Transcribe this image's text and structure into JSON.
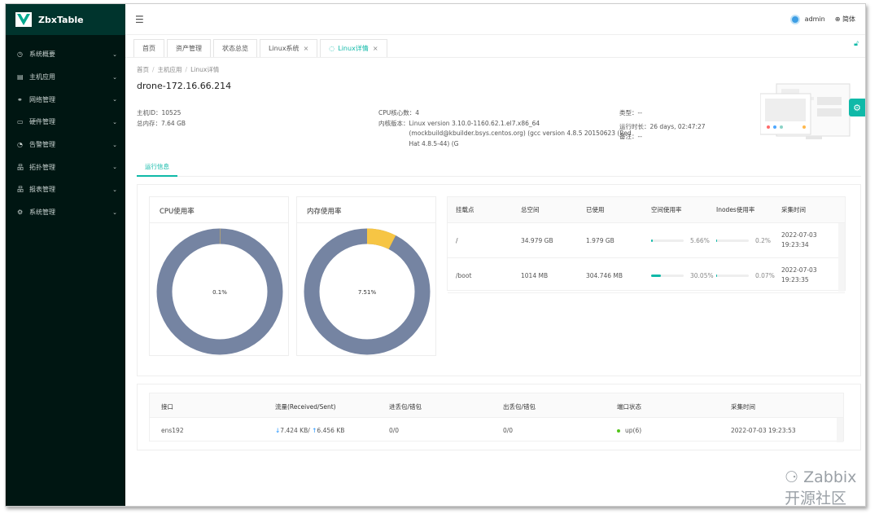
{
  "app": {
    "title": "ZbxTable"
  },
  "sidebar": {
    "items": [
      {
        "label": "系统概要",
        "icon": "dashboard-icon",
        "glyph": "◷"
      },
      {
        "label": "主机应用",
        "icon": "server-icon",
        "glyph": "▤"
      },
      {
        "label": "网络管理",
        "icon": "network-icon",
        "glyph": "⚭"
      },
      {
        "label": "硬件管理",
        "icon": "folder-icon",
        "glyph": "▭"
      },
      {
        "label": "告警管理",
        "icon": "alarm-icon",
        "glyph": "◔"
      },
      {
        "label": "拓扑管理",
        "icon": "topology-icon",
        "glyph": "品"
      },
      {
        "label": "报表管理",
        "icon": "report-icon",
        "glyph": "品"
      },
      {
        "label": "系统管理",
        "icon": "gear-icon",
        "glyph": "⚙"
      }
    ]
  },
  "header": {
    "user": "admin",
    "lang": "简体"
  },
  "tabs": [
    {
      "label": "首页",
      "closable": false,
      "active": false
    },
    {
      "label": "资产管理",
      "closable": false,
      "active": false
    },
    {
      "label": "状态总览",
      "closable": false,
      "active": false
    },
    {
      "label": "Linux系统",
      "closable": true,
      "active": false
    },
    {
      "label": "Linux详情",
      "closable": true,
      "active": true
    }
  ],
  "breadcrumb": {
    "items": [
      "首页",
      "主机应用",
      "Linux详情"
    ],
    "sep": "/"
  },
  "host": {
    "name": "drone-172.16.66.214",
    "id_label": "主机ID：",
    "id": "10525",
    "mem_label": "总内存：",
    "mem": "7.64 GB",
    "cpu_label": "CPU核心数：",
    "cpu": "4",
    "kernel_label": "内核版本：",
    "kernel_1": "Linux version 3.10.0-1160.62.1.el7.x86_64",
    "kernel_2": "(mockbuild@kbuilder.bsys.centos.org) (gcc version 4.8.5 20150623 (Red",
    "kernel_3": "Hat 4.8.5-44) (G",
    "type_label": "类型：",
    "type": "--",
    "uptime_label": "运行时长：",
    "uptime": "26 days, 02:47:27",
    "note_label": "备注：",
    "note": "--"
  },
  "subtab": "运行信息",
  "cpu_card": {
    "title": "CPU使用率",
    "value": 0.1,
    "label": "0.1%"
  },
  "mem_card": {
    "title": "内存使用率",
    "value": 7.51,
    "label": "7.51%"
  },
  "colors": {
    "accent": "#0fb9a8",
    "donut_base": "#7584a2",
    "donut_used": "#f6c544"
  },
  "fs_table": {
    "headers": [
      "挂载点",
      "总空间",
      "已使用",
      "空间使用率",
      "Inodes使用率",
      "采集时间"
    ],
    "rows": [
      {
        "mount": "/",
        "total": "34.979 GB",
        "used": "1.979 GB",
        "space_pct": 5.66,
        "space_label": "5.66%",
        "inode_pct": 0.2,
        "inode_label": "0.2%",
        "time1": "2022-07-03",
        "time2": "19:23:34"
      },
      {
        "mount": "/boot",
        "total": "1014 MB",
        "used": "304.746 MB",
        "space_pct": 30.05,
        "space_label": "30.05%",
        "inode_pct": 0.07,
        "inode_label": "0.07%",
        "time1": "2022-07-03",
        "time2": "19:23:35"
      }
    ]
  },
  "net_table": {
    "headers": [
      "接口",
      "流量(Received/Sent)",
      "进丢包/错包",
      "出丢包/错包",
      "端口状态",
      "采集时间"
    ],
    "rows": [
      {
        "iface": "ens192",
        "recv": "7.424 KB/",
        "sent": "6.456 KB",
        "in_err": "0/0",
        "out_err": "0/0",
        "status": "up(6)",
        "time": "2022-07-03 19:23:53"
      }
    ]
  },
  "watermark": "Zabbix开源社区"
}
